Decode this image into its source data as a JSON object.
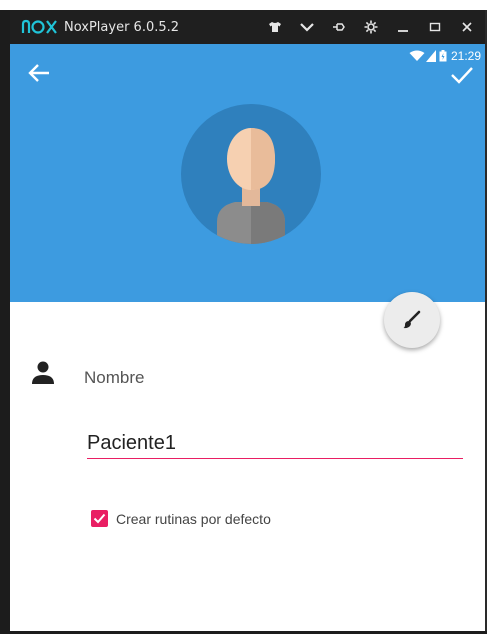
{
  "window": {
    "title": "NoxPlayer 6.0.5.2",
    "icons": [
      "tshirt-icon",
      "chevron-down-icon",
      "pin-icon",
      "settings-icon",
      "minimize-icon",
      "maximize-icon",
      "close-icon"
    ]
  },
  "status_bar": {
    "time": "21:29",
    "icons": [
      "wifi-icon",
      "signal-icon",
      "battery-icon"
    ]
  },
  "toolbar": {
    "back_icon": "arrow-left-icon",
    "save_icon": "check-icon"
  },
  "profile": {
    "avatar_icon": "person-avatar-icon",
    "edit_icon": "brush-icon"
  },
  "form": {
    "name_label": "Nombre",
    "name_value": "Paciente1",
    "checkbox_label": "Crear rutinas por defecto",
    "checkbox_checked": true
  },
  "colors": {
    "header": "#3d9be0",
    "avatar_bg": "#2f80bd",
    "accent": "#e91e63",
    "titlebar": "#1f1f1f"
  }
}
